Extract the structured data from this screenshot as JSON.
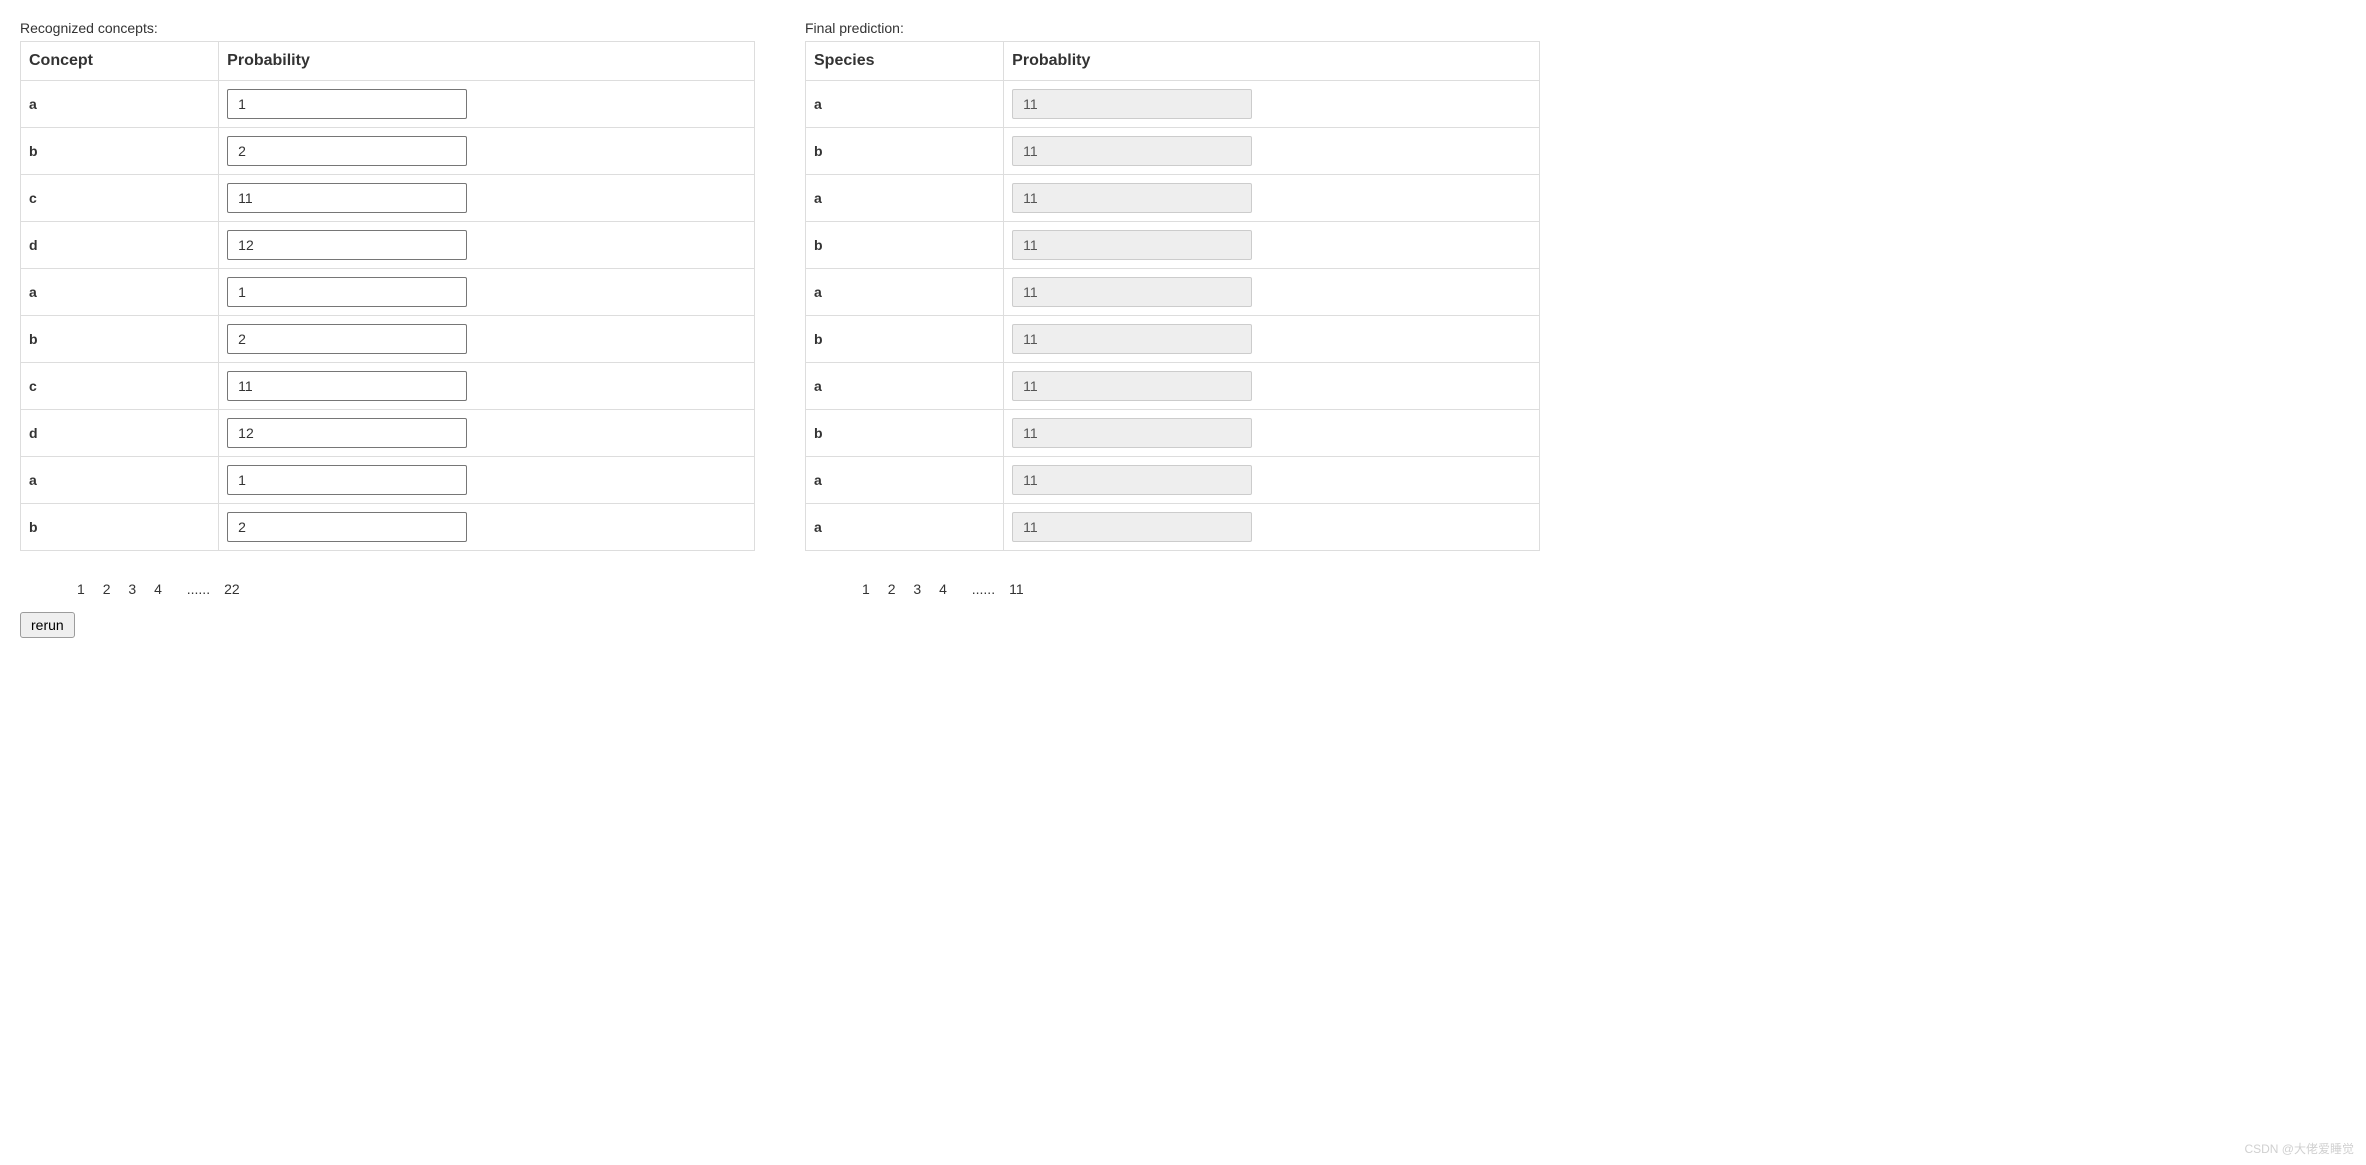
{
  "left": {
    "title": "Recognized concepts:",
    "headers": {
      "col1": "Concept",
      "col2": "Probability"
    },
    "rows": [
      {
        "label": "a",
        "value": "1"
      },
      {
        "label": "b",
        "value": "2"
      },
      {
        "label": "c",
        "value": "11"
      },
      {
        "label": "d",
        "value": "12"
      },
      {
        "label": "a",
        "value": "1"
      },
      {
        "label": "b",
        "value": "2"
      },
      {
        "label": "c",
        "value": "11"
      },
      {
        "label": "d",
        "value": "12"
      },
      {
        "label": "a",
        "value": "1"
      },
      {
        "label": "b",
        "value": "2"
      }
    ],
    "pagination": {
      "pages": [
        "1",
        "2",
        "3",
        "4"
      ],
      "ellipsis": "......",
      "last": "22"
    }
  },
  "right": {
    "title": "Final prediction:",
    "headers": {
      "col1": "Species",
      "col2": "Probablity"
    },
    "rows": [
      {
        "label": "a",
        "value": "11"
      },
      {
        "label": "b",
        "value": "11"
      },
      {
        "label": "a",
        "value": "11"
      },
      {
        "label": "b",
        "value": "11"
      },
      {
        "label": "a",
        "value": "11"
      },
      {
        "label": "b",
        "value": "11"
      },
      {
        "label": "a",
        "value": "11"
      },
      {
        "label": "b",
        "value": "11"
      },
      {
        "label": "a",
        "value": "11"
      },
      {
        "label": "a",
        "value": "11"
      }
    ],
    "pagination": {
      "pages": [
        "1",
        "2",
        "3",
        "4"
      ],
      "ellipsis": "......",
      "last": "11"
    }
  },
  "button": {
    "rerun": "rerun"
  },
  "watermark": "CSDN @大佬爱睡觉"
}
